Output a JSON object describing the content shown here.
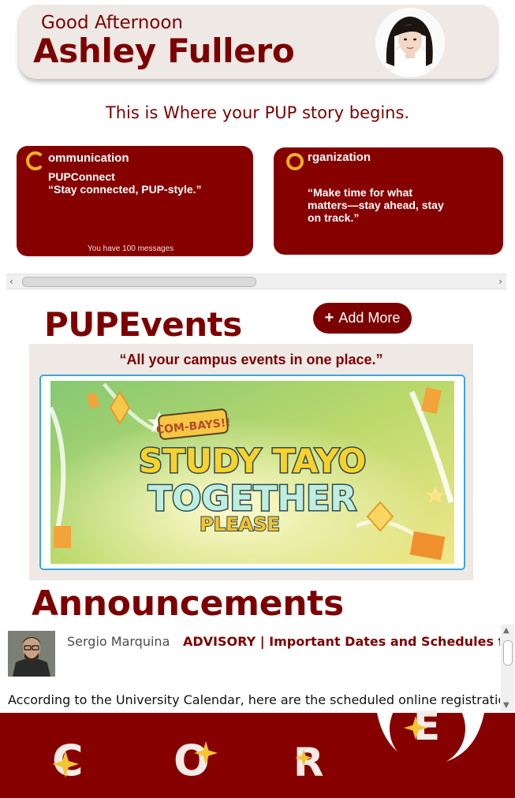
{
  "header": {
    "greeting": "Good Afternoon",
    "user_name": "Ashley Fullero",
    "avatar_icon": "user-avatar-photo"
  },
  "tagline": "This is Where your PUP story begins.",
  "cards": [
    {
      "letter": "C",
      "title": "ommunication",
      "subtitle_line1": "PUPConnect",
      "subtitle_line2": "“Stay connected, PUP-style.”",
      "footer": "You have 100 messages"
    },
    {
      "letter": "O",
      "title": "rganization",
      "subtitle_line1": "“Make time for what",
      "subtitle_line2": "matters—stay ahead, stay",
      "subtitle_line3": "on track.”"
    }
  ],
  "events": {
    "title": "PUPEvents",
    "add_label": "Add More",
    "quote": "“All your campus events in one place.”",
    "poster": {
      "kicker": "COM-BAYS!!",
      "line1": "STUDY TAYO",
      "line2": "TOGETHER",
      "line3": "PLEASE"
    }
  },
  "announcements": {
    "title": "Announcements",
    "author": "Sergio Marquina",
    "headline": "ADVISORY | Important Dates and Schedules for the",
    "body": "According to the University Calendar, here are the scheduled online registration"
  },
  "bottom_nav": {
    "items": [
      "C",
      "O",
      "R",
      "E"
    ]
  },
  "colors": {
    "maroon": "#7d0000",
    "card_bg": "#870000",
    "gold": "#f2b31c",
    "panel": "#efe9e6"
  }
}
